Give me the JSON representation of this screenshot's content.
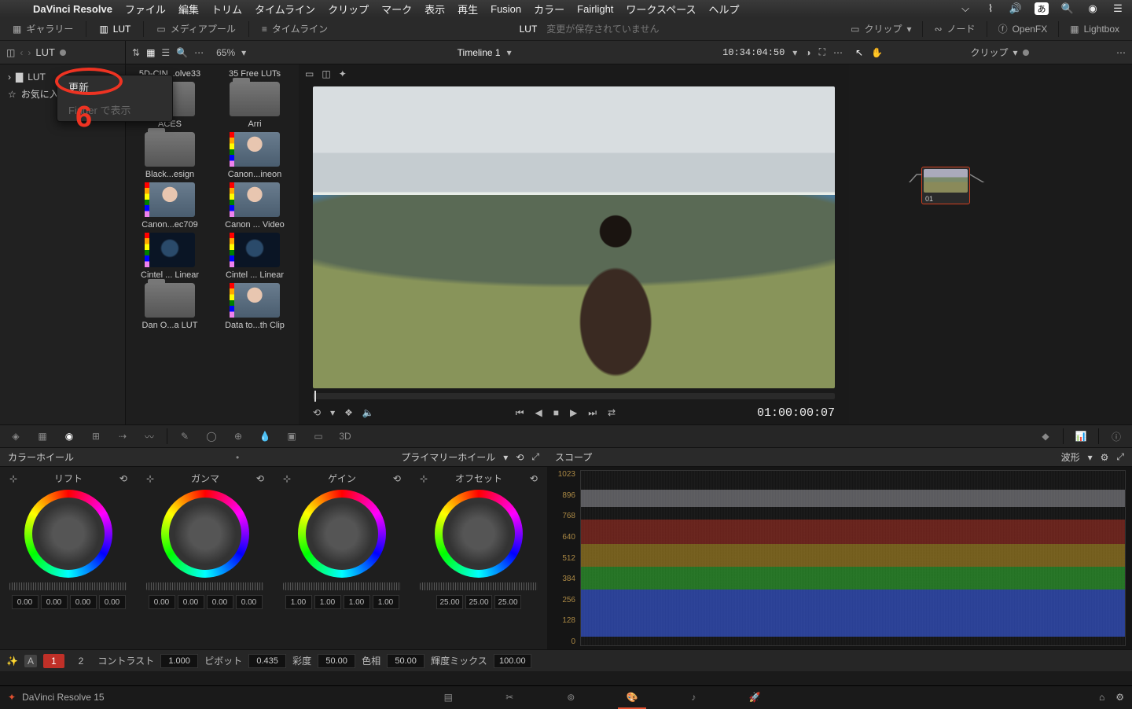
{
  "menubar": {
    "app": "DaVinci Resolve",
    "items": [
      "ファイル",
      "編集",
      "トリム",
      "タイムライン",
      "クリップ",
      "マーク",
      "表示",
      "再生",
      "Fusion",
      "カラー",
      "Fairlight",
      "ワークスペース",
      "ヘルプ"
    ],
    "ime": "あ"
  },
  "topbar": {
    "gallery": "ギャラリー",
    "lut": "LUT",
    "mediapool": "メディアプール",
    "timeline": "タイムライン",
    "center_title": "LUT",
    "center_status": "変更が保存されていません",
    "clip": "クリップ",
    "node": "ノード",
    "openfx": "OpenFX",
    "lightbox": "Lightbox"
  },
  "subbar": {
    "crumb": "LUT",
    "zoom": "65%",
    "timeline": "Timeline 1",
    "timecode": "10:34:04:50",
    "node_clip": "クリップ"
  },
  "sidebar": {
    "row1": "LUT",
    "row2": "お気に入り"
  },
  "context_menu": {
    "refresh": "更新",
    "show_finder": "Finder で表示"
  },
  "annotation": {
    "num": "6"
  },
  "luts": [
    {
      "label": "5D-CIN...olve33",
      "type": ""
    },
    {
      "label": "35 Free LUTs",
      "type": ""
    },
    {
      "label": "ACES",
      "type": "folder"
    },
    {
      "label": "Arri",
      "type": "folder"
    },
    {
      "label": "Black...esign",
      "type": "folder"
    },
    {
      "label": "Canon...ineon",
      "type": "face bars"
    },
    {
      "label": "Canon...ec709",
      "type": "face bars"
    },
    {
      "label": "Canon ... Video",
      "type": "face bars"
    },
    {
      "label": "Cintel ... Linear",
      "type": "dark bars"
    },
    {
      "label": "Cintel ... Linear",
      "type": "dark bars"
    },
    {
      "label": "Dan O...a LUT",
      "type": "folder"
    },
    {
      "label": "Data to...th Clip",
      "type": "face bars"
    }
  ],
  "transport": {
    "tc": "01:00:00:07"
  },
  "node": {
    "label": "01"
  },
  "panels": {
    "wheels_title": "カラーホイール",
    "wheels_mode": "プライマリーホイール",
    "scope_title": "スコープ",
    "scope_mode": "波形"
  },
  "wheels": [
    {
      "name": "リフト",
      "vals": [
        "0.00",
        "0.00",
        "0.00",
        "0.00"
      ]
    },
    {
      "name": "ガンマ",
      "vals": [
        "0.00",
        "0.00",
        "0.00",
        "0.00"
      ]
    },
    {
      "name": "ゲイン",
      "vals": [
        "1.00",
        "1.00",
        "1.00",
        "1.00"
      ]
    },
    {
      "name": "オフセット",
      "vals": [
        "25.00",
        "25.00",
        "25.00"
      ]
    }
  ],
  "scope_ticks": [
    "1023",
    "896",
    "768",
    "640",
    "512",
    "384",
    "256",
    "128",
    "0"
  ],
  "adjust": {
    "pages": [
      "1",
      "2"
    ],
    "contrast_label": "コントラスト",
    "contrast": "1.000",
    "pivot_label": "ピボット",
    "pivot": "0.435",
    "sat_label": "彩度",
    "sat": "50.00",
    "hue_label": "色相",
    "hue": "50.00",
    "lummix_label": "輝度ミックス",
    "lummix": "100.00"
  },
  "footer": {
    "version": "DaVinci Resolve 15"
  }
}
